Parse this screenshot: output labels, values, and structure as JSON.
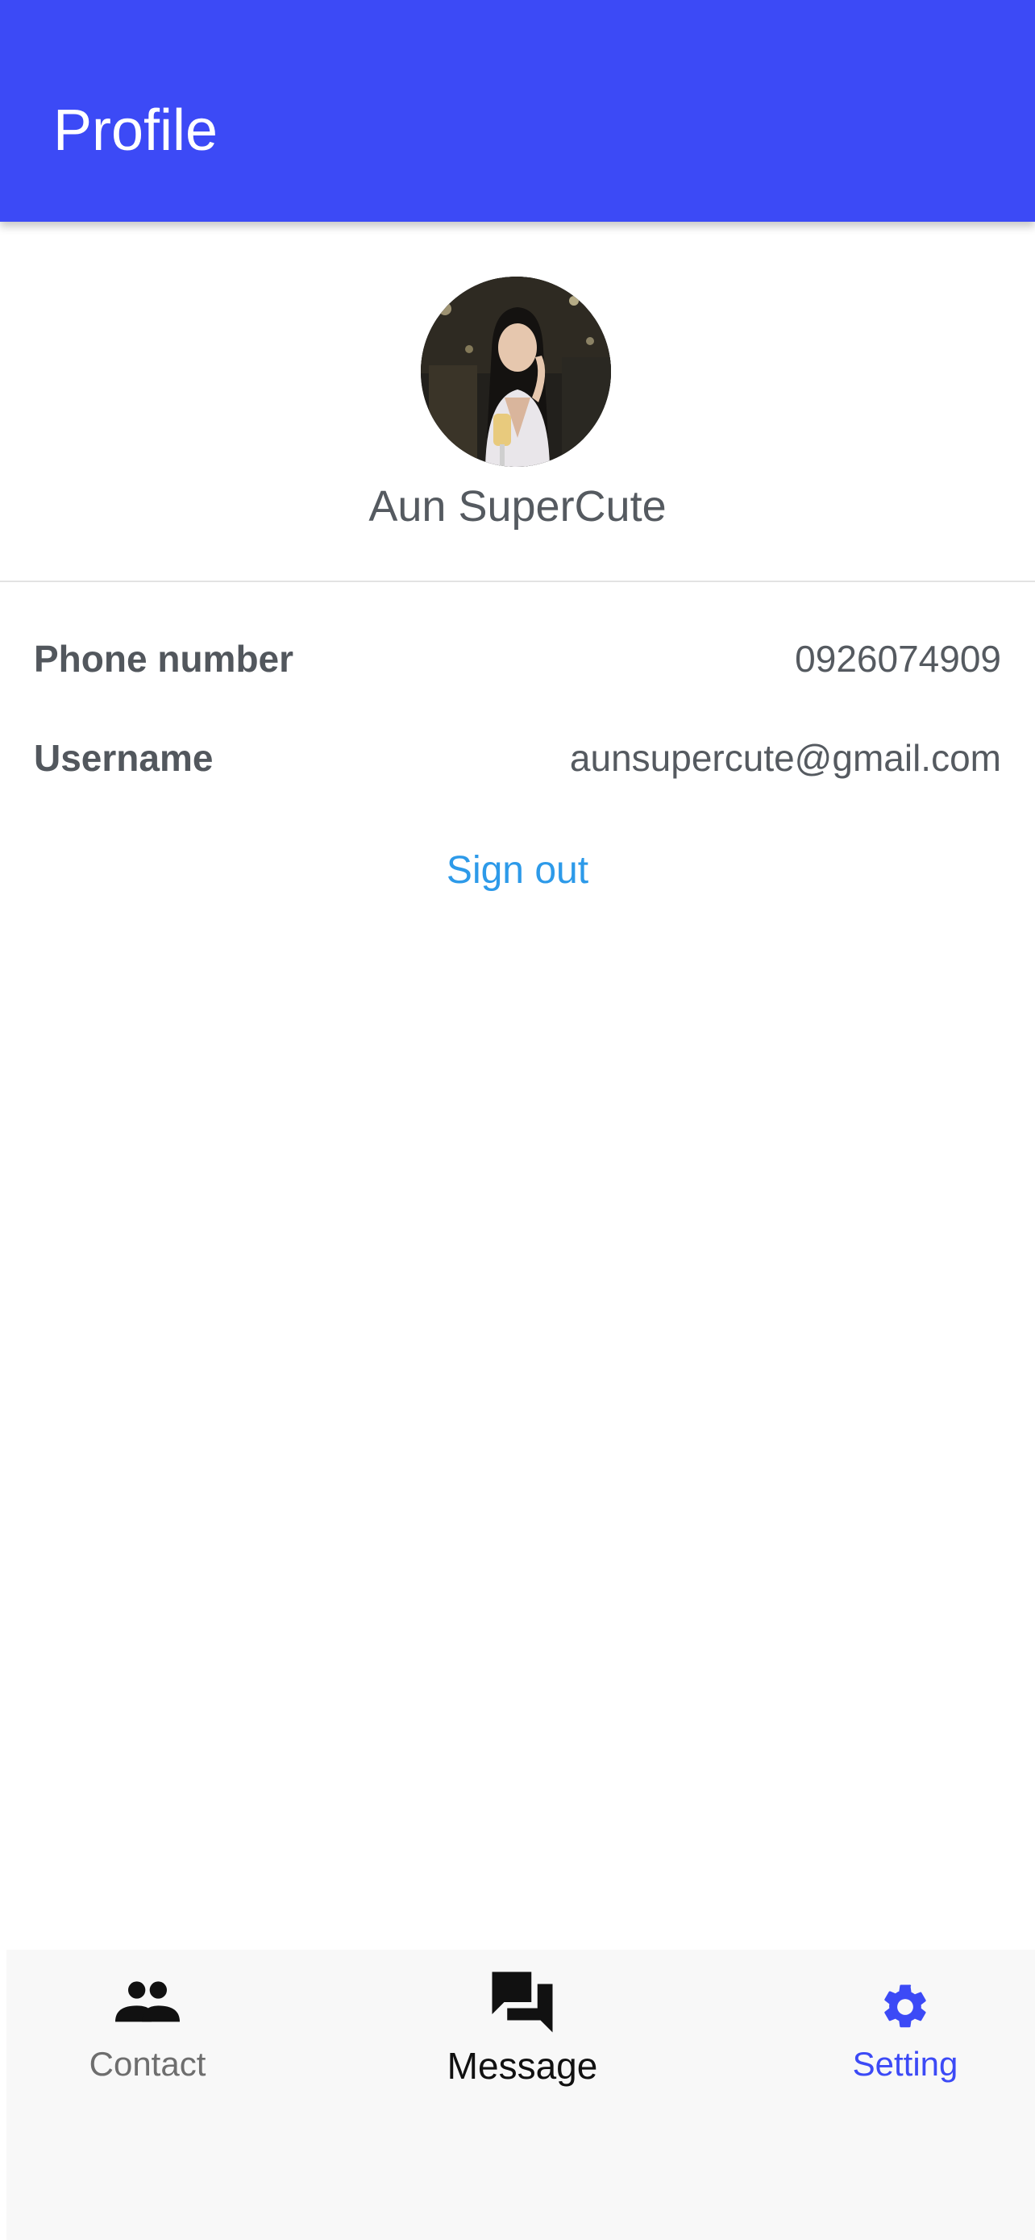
{
  "app_bar": {
    "title": "Profile",
    "background_color": "#3c4af6"
  },
  "profile": {
    "avatar_icon": "profile-photo",
    "name": "Aun SuperCute"
  },
  "details": [
    {
      "label": "Phone number",
      "value": "0926074909"
    },
    {
      "label": "Username",
      "value": "aunsupercute@gmail.com"
    }
  ],
  "actions": {
    "sign_out": "Sign out",
    "sign_out_color": "#2d9ae9"
  },
  "bottom_nav": {
    "active": "Setting",
    "active_color": "#3c4af6",
    "items": [
      {
        "label": "Contact",
        "icon": "people-icon"
      },
      {
        "label": "Message",
        "icon": "forum-icon"
      },
      {
        "label": "Setting",
        "icon": "gear-icon"
      }
    ]
  }
}
